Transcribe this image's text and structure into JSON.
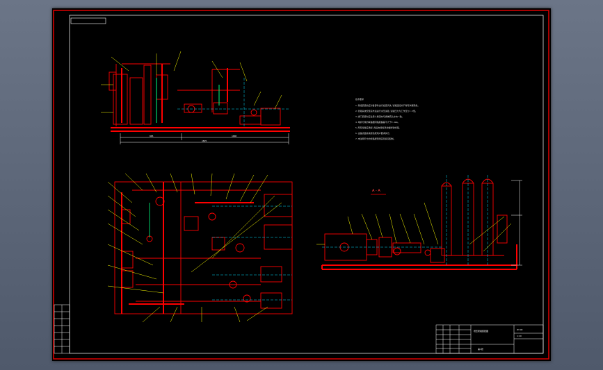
{
  "drawing": {
    "notes_title": "技术要求",
    "notes_lines": [
      "1.泵组安装前应对各部件进行检查清洗,管路连接处不得有渗漏现象。",
      "2.管路系统安装完毕后进行水压试验,试验压力为工作压力1.5倍。",
      "3.阀门安装时应注意介质流向与阀体箭头方向一致。",
      "4.电机与泵的联轴器同轴度偏差不大于0.1mm。",
      "5.所有焊缝应满焊,焊后去除焊渣并做防锈处理。",
      "6.设备表面涂漆颜色按用户要求执行。",
      "7.未注明尺寸的管路按现场实际情况配制。"
    ],
    "section_label": "A - A",
    "top_view_dims": [
      "805",
      "1000",
      "1825"
    ],
    "title_block": {
      "name": "增压泵组装配图",
      "drawing_no": "ZY-00",
      "scale": "1:10",
      "sheet": "第1张"
    }
  },
  "colors": {
    "frame": "#e00000",
    "geometry": "#ff0000",
    "dimension": "#ffffff",
    "leader": "#ffff00",
    "centerline": "#00e0ff",
    "pipe": "#00ff80"
  }
}
